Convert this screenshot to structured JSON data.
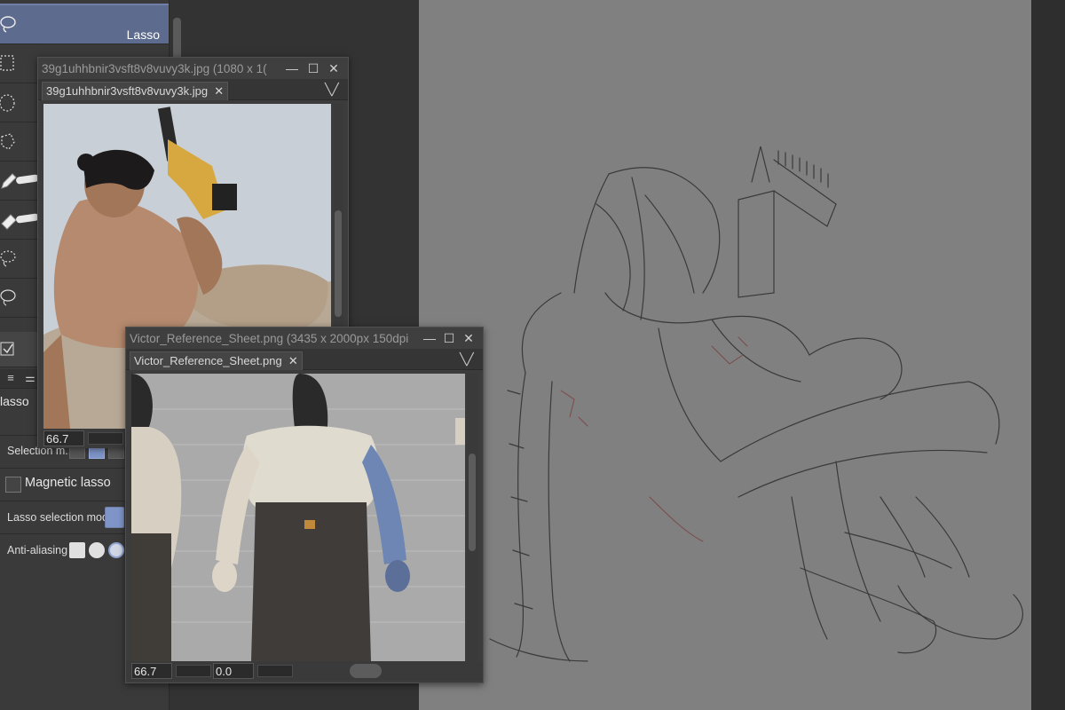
{
  "tool_panel": {
    "active_tool_label": "Lasso",
    "sub_tool_name": "lasso",
    "selection_label": "Selection m...",
    "magnetic_lasso_label": "Magnetic lasso",
    "lasso_mode_label": "Lasso selection mode",
    "anti_aliasing_label": "Anti-aliasing",
    "icons": [
      "lasso-icon",
      "rect-marquee-icon",
      "ellipse-marquee-icon",
      "polyline-icon",
      "pen-icon",
      "eraser-icon",
      "lasso-alt-icon",
      "lasso-alt2-icon",
      "checkbox-icon"
    ]
  },
  "reference_window_1": {
    "title": "39g1uhhbnir3vsft8v8vuvy3k.jpg (1080 x 1(",
    "tab_label": "39g1uhhbnir3vsft8v8vuvy3k.jpg",
    "zoom_value": "66.7"
  },
  "reference_window_2": {
    "title": "Victor_Reference_Sheet.png (3435 x 2000px 150dpi",
    "tab_label": "Victor_Reference_Sheet.png",
    "zoom_value": "66.7",
    "rotation_value": "0.0"
  },
  "colors": {
    "active_tool": "#5d6b8e",
    "canvas": "#808080",
    "panel": "#3a3a3a"
  }
}
